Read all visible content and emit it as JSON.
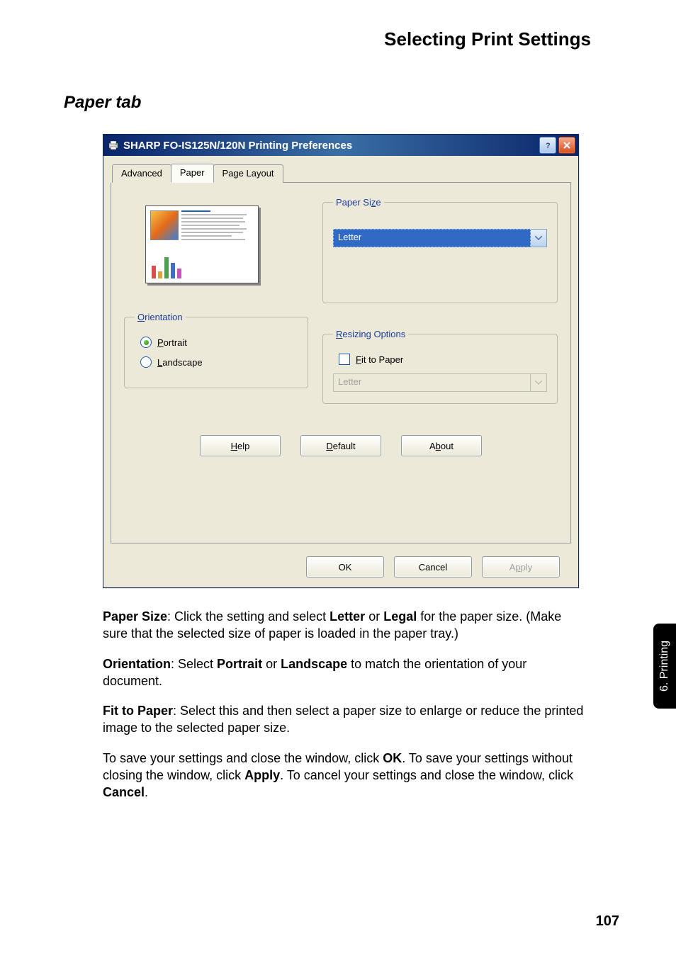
{
  "header": {
    "title": "Selecting Print Settings"
  },
  "section": {
    "title": "Paper tab"
  },
  "dialog": {
    "title": "SHARP FO-IS125N/120N Printing Preferences",
    "tabs": {
      "advanced": "Advanced",
      "paper": "Paper",
      "page_layout": "Page Layout",
      "active": "Paper"
    },
    "groups": {
      "paper_size": {
        "legend_prefix": "Paper Si",
        "legend_u": "z",
        "legend_suffix": "e",
        "value": "Letter"
      },
      "orientation": {
        "legend_u": "O",
        "legend_suffix": "rientation",
        "portrait_u": "P",
        "portrait_suffix": "ortrait",
        "landscape_u": "L",
        "landscape_suffix": "andscape",
        "selected": "Portrait"
      },
      "resizing": {
        "legend_u": "R",
        "legend_suffix": "esizing Options",
        "fit_u": "F",
        "fit_suffix": "it to Paper",
        "fit_checked": false,
        "fit_value": "Letter"
      }
    },
    "buttons": {
      "help_u": "H",
      "help_suffix": "elp",
      "default_u": "D",
      "default_suffix": "efault",
      "about_prefix": "A",
      "about_u": "b",
      "about_suffix": "out",
      "ok": "OK",
      "cancel": "Cancel",
      "apply_prefix": "A",
      "apply_u": "p",
      "apply_suffix": "ply"
    }
  },
  "body": {
    "p1_b1": "Paper Size",
    "p1_t1": ": Click the setting and select ",
    "p1_b2": "Letter",
    "p1_t2": " or ",
    "p1_b3": "Legal",
    "p1_t3": " for the paper size. (Make sure that the selected size of paper is loaded in the paper tray.)",
    "p2_b1": "Orientation",
    "p2_t1": ": Select ",
    "p2_b2": "Portrait",
    "p2_t2": " or ",
    "p2_b3": "Landscape",
    "p2_t3": " to match the orientation of your document.",
    "p3_b1": "Fit to Paper",
    "p3_t1": ": Select this and then select a paper size to enlarge or reduce the printed image to the selected paper size.",
    "p4_t1": "To save your settings and close the window, click ",
    "p4_b1": "OK",
    "p4_t2": ". To save your settings without closing the window, click ",
    "p4_b2": "Apply",
    "p4_t3": ". To cancel your settings and close the window, click ",
    "p4_b3": "Cancel",
    "p4_t4": "."
  },
  "side_tab": "6. Printing",
  "page_number": "107"
}
